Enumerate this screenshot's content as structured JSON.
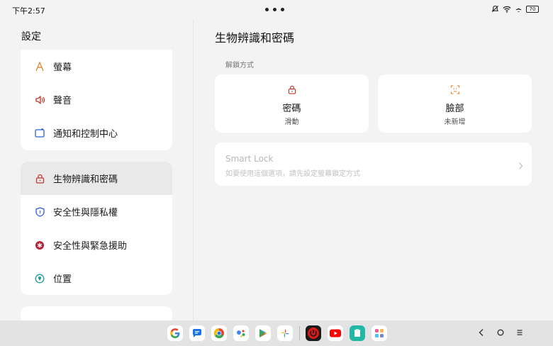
{
  "status_bar": {
    "time": "下午2:57",
    "battery": "70"
  },
  "left_panel": {
    "title": "設定",
    "group1": [
      {
        "label": "螢幕",
        "icon": "display-icon"
      },
      {
        "label": "聲音",
        "icon": "speaker-icon"
      },
      {
        "label": "通知和控制中心",
        "icon": "notification-icon"
      }
    ],
    "group2": [
      {
        "label": "生物辨識和密碼",
        "icon": "lock-icon",
        "active": true
      },
      {
        "label": "安全性與隱私權",
        "icon": "shield-icon"
      },
      {
        "label": "安全性與緊急援助",
        "icon": "emergency-icon"
      },
      {
        "label": "位置",
        "icon": "location-icon"
      }
    ]
  },
  "main": {
    "title": "生物辨識和密碼",
    "section_label": "解鎖方式",
    "cards": [
      {
        "title": "密碼",
        "subtitle": "滑動",
        "icon": "lock-icon"
      },
      {
        "title": "臉部",
        "subtitle": "未新增",
        "icon": "face-scan-icon"
      }
    ],
    "smart_lock": {
      "title": "Smart Lock",
      "subtitle": "如要使用這個選項，請先設定螢幕鎖定方式"
    }
  },
  "colors": {
    "accent_red": "#c0392b",
    "accent_orange": "#e08a3c",
    "accent_teal": "#1d9a9a",
    "accent_blue": "#2b5fd9"
  },
  "taskbar": {
    "apps": [
      "google-icon",
      "messages-icon",
      "chrome-icon",
      "assistant-icon",
      "play-store-icon",
      "photos-icon",
      "power-app-icon",
      "youtube-icon",
      "files-icon",
      "app-drawer-icon"
    ]
  }
}
